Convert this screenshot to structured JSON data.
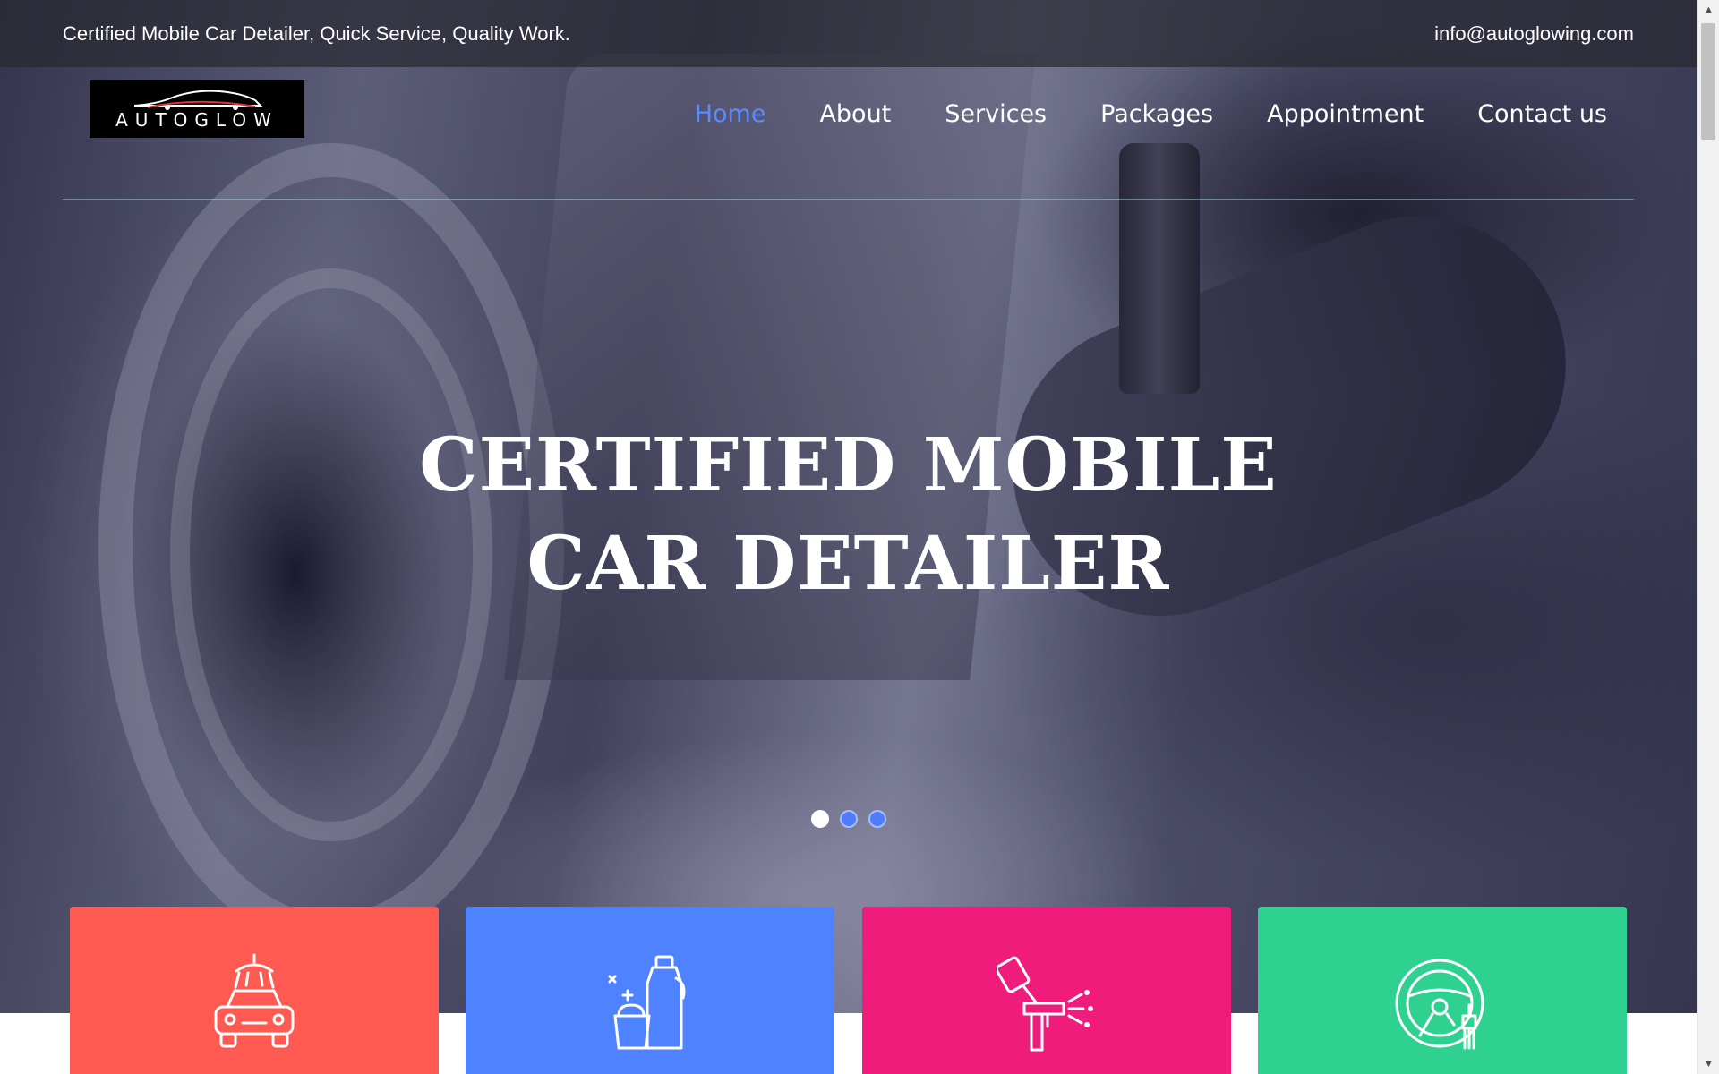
{
  "topbar": {
    "tagline": "Certified Mobile Car Detailer, Quick Service, Quality Work.",
    "email": "info@autoglowing.com"
  },
  "logo": {
    "text": "AUTOGLOW"
  },
  "nav": {
    "items": [
      {
        "label": "Home",
        "active": true
      },
      {
        "label": "About",
        "active": false
      },
      {
        "label": "Services",
        "active": false
      },
      {
        "label": "Packages",
        "active": false
      },
      {
        "label": "Appointment",
        "active": false
      },
      {
        "label": "Contact us",
        "active": false
      }
    ]
  },
  "hero": {
    "title_line1": "CERTIFIED MOBILE",
    "title_line2": "CAR DETAILER",
    "slides_total": 3,
    "active_slide": 1
  },
  "cards": [
    {
      "icon": "car-wash-icon",
      "color": "#ff5a52"
    },
    {
      "icon": "cleaning-products-icon",
      "color": "#4f82ff"
    },
    {
      "icon": "spray-gun-icon",
      "color": "#f01c7c"
    },
    {
      "icon": "steering-wheel-icon",
      "color": "#2ed18f"
    }
  ],
  "colors": {
    "accent": "#5b8cff",
    "topbar_bg": "#28282f"
  }
}
